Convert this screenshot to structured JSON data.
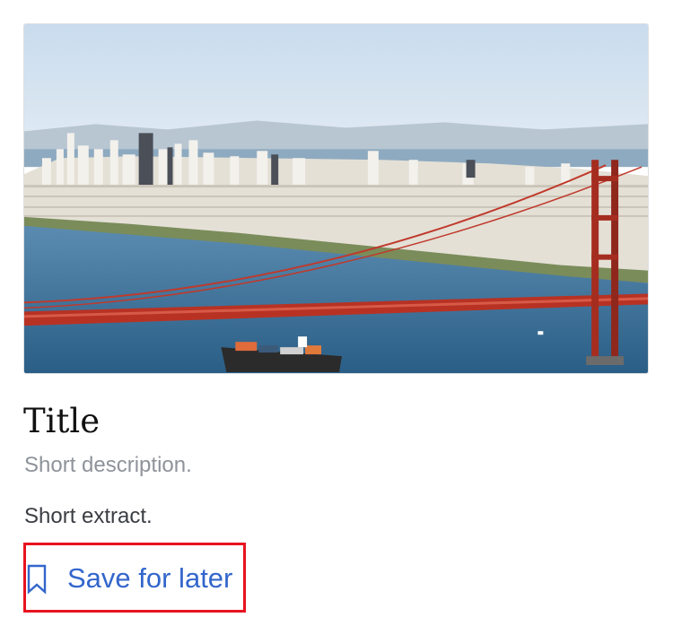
{
  "card": {
    "image_alt": "San Francisco skyline and Golden Gate Bridge",
    "title": "Title",
    "description": "Short description.",
    "extract": "Short extract.",
    "save_button": {
      "label": "Save for later",
      "icon": "bookmark-icon"
    }
  },
  "colors": {
    "link": "#3366cc",
    "description": "#8e939a",
    "highlight_border": "#e8131f"
  }
}
